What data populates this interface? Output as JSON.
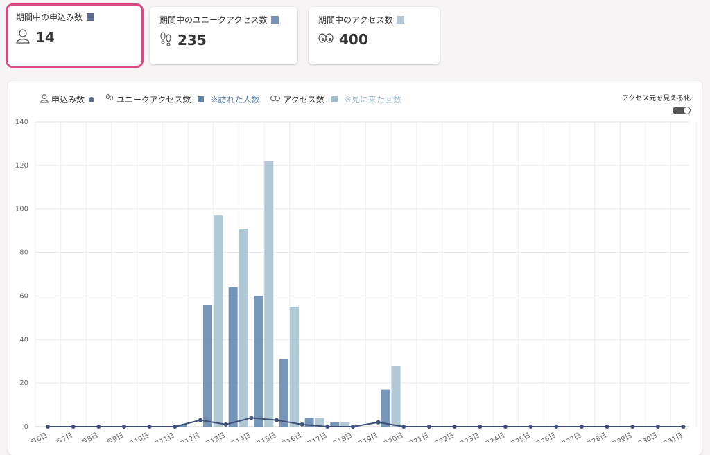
{
  "cards": [
    {
      "title": "期間中の申込み数",
      "value": "14",
      "color": "#5a6b8c",
      "icon": "person-icon"
    },
    {
      "title": "期間中のユニークアクセス数",
      "value": "235",
      "color": "#7593b8",
      "icon": "footprints-icon"
    },
    {
      "title": "期間中のアクセス数",
      "value": "400",
      "color": "#b4c8d6",
      "icon": "eyes-icon"
    }
  ],
  "legend": {
    "applications": "申込み数",
    "unique": "ユニークアクセス数",
    "unique_note": "※訪れた人数",
    "access": "アクセス数",
    "access_note": "※見に来た回数"
  },
  "toggle": {
    "label": "アクセス元を見える化",
    "state": "on"
  },
  "colors": {
    "applications": "#3f5078",
    "unique": "#5d82ad",
    "access": "#a3bfcf",
    "selected_border": "#d94a82"
  },
  "chart_data": {
    "type": "bar",
    "categories": [
      "6日",
      "7日",
      "8日",
      "9日",
      "10日",
      "11日",
      "12日",
      "13日",
      "14日",
      "15日",
      "16日",
      "17日",
      "18日",
      "19日",
      "20日",
      "21日",
      "22日",
      "23日",
      "24日",
      "25日",
      "26日",
      "27日",
      "28日",
      "29日",
      "30日",
      "31日"
    ],
    "category_prefix_visible": "月",
    "ylim": [
      0,
      140
    ],
    "yticks": [
      0,
      20,
      40,
      60,
      80,
      100,
      120,
      140
    ],
    "series": [
      {
        "name": "ユニークアクセス数",
        "type": "bar",
        "values": [
          0,
          0,
          0,
          0,
          0,
          1,
          56,
          64,
          60,
          31,
          4,
          2,
          0,
          17,
          0,
          0,
          0,
          0,
          0,
          0,
          0,
          0,
          0,
          0,
          0,
          0
        ]
      },
      {
        "name": "アクセス数",
        "type": "bar",
        "values": [
          0,
          0,
          0,
          0,
          0,
          0,
          97,
          91,
          122,
          55,
          4,
          2,
          0,
          28,
          0,
          0,
          0,
          0,
          0,
          0,
          0,
          0,
          0,
          0,
          0,
          0
        ]
      },
      {
        "name": "申込み数",
        "type": "line",
        "values": [
          0,
          0,
          0,
          0,
          0,
          0,
          3,
          1,
          4,
          3,
          1,
          0,
          0,
          2,
          0,
          0,
          0,
          0,
          0,
          0,
          0,
          0,
          0,
          0,
          0,
          0
        ]
      }
    ],
    "grid": true
  }
}
